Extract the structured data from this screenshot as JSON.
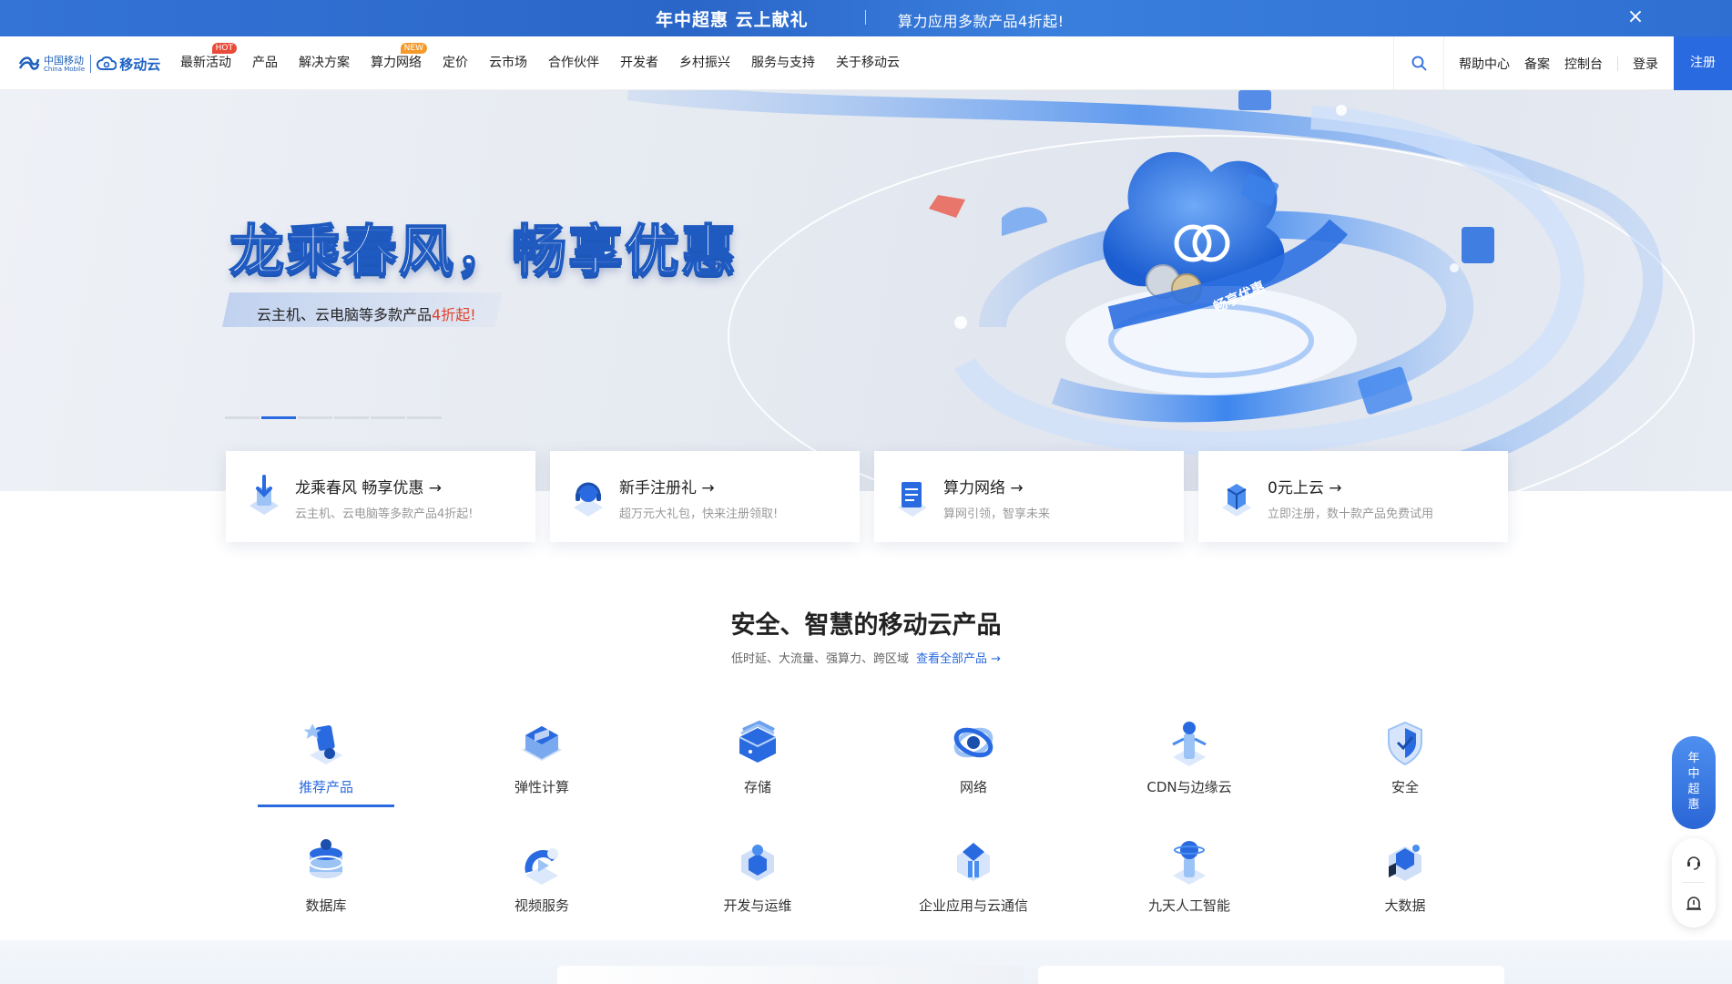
{
  "promo": {
    "main": "年中超惠 云上献礼",
    "sub": "算力应用多款产品4折起!",
    "close_icon": "close-icon"
  },
  "logo": {
    "cm_cn": "中国移动",
    "cm_en": "China Mobile",
    "brand": "移动云"
  },
  "nav": {
    "items": [
      {
        "label": "最新活动",
        "badge": "HOT"
      },
      {
        "label": "产品",
        "badge": ""
      },
      {
        "label": "解决方案",
        "badge": ""
      },
      {
        "label": "算力网络",
        "badge": "NEW"
      },
      {
        "label": "定价",
        "badge": ""
      },
      {
        "label": "云市场",
        "badge": ""
      },
      {
        "label": "合作伙伴",
        "badge": ""
      },
      {
        "label": "开发者",
        "badge": ""
      },
      {
        "label": "乡村振兴",
        "badge": ""
      },
      {
        "label": "服务与支持",
        "badge": ""
      },
      {
        "label": "关于移动云",
        "badge": ""
      }
    ],
    "help": "帮助中心",
    "record": "备案",
    "console": "控制台",
    "login": "登录",
    "register": "注册"
  },
  "hero": {
    "title": "龙乘春风，畅享优惠",
    "subtitle_prefix": "云主机、云电脑等多款产品",
    "subtitle_highlight": "4折起!",
    "slides_total": 6,
    "active_slide": 2,
    "badge_text": "畅享优惠"
  },
  "quick_cards": [
    {
      "title": "龙乘春风 畅享优惠 →",
      "desc": "云主机、云电脑等多款产品4折起!"
    },
    {
      "title": "新手注册礼 →",
      "desc": "超万元大礼包，快来注册领取!"
    },
    {
      "title": "算力网络 →",
      "desc": "算网引领，智享未来"
    },
    {
      "title": "0元上云 →",
      "desc": "立即注册，数十款产品免费试用"
    }
  ],
  "products": {
    "title": "安全、智慧的移动云产品",
    "subtitle": "低时延、大流量、强算力、跨区域",
    "link": "查看全部产品 →",
    "categories": [
      {
        "label": "推荐产品",
        "icon": "recommend-icon"
      },
      {
        "label": "弹性计算",
        "icon": "compute-icon"
      },
      {
        "label": "存储",
        "icon": "storage-icon"
      },
      {
        "label": "网络",
        "icon": "network-icon"
      },
      {
        "label": "CDN与边缘云",
        "icon": "cdn-icon"
      },
      {
        "label": "安全",
        "icon": "security-icon"
      },
      {
        "label": "数据库",
        "icon": "database-icon"
      },
      {
        "label": "视频服务",
        "icon": "video-icon"
      },
      {
        "label": "开发与运维",
        "icon": "devops-icon"
      },
      {
        "label": "企业应用与云通信",
        "icon": "enterprise-icon"
      },
      {
        "label": "九天人工智能",
        "icon": "ai-icon"
      },
      {
        "label": "大数据",
        "icon": "bigdata-icon"
      }
    ],
    "active": "推荐产品"
  },
  "floatbar": {
    "promo": "年中超惠"
  },
  "colors": {
    "primary": "#2a6ae0",
    "hot": "#e84b3a",
    "new": "#f39a2b",
    "highlight": "#e2422b"
  }
}
